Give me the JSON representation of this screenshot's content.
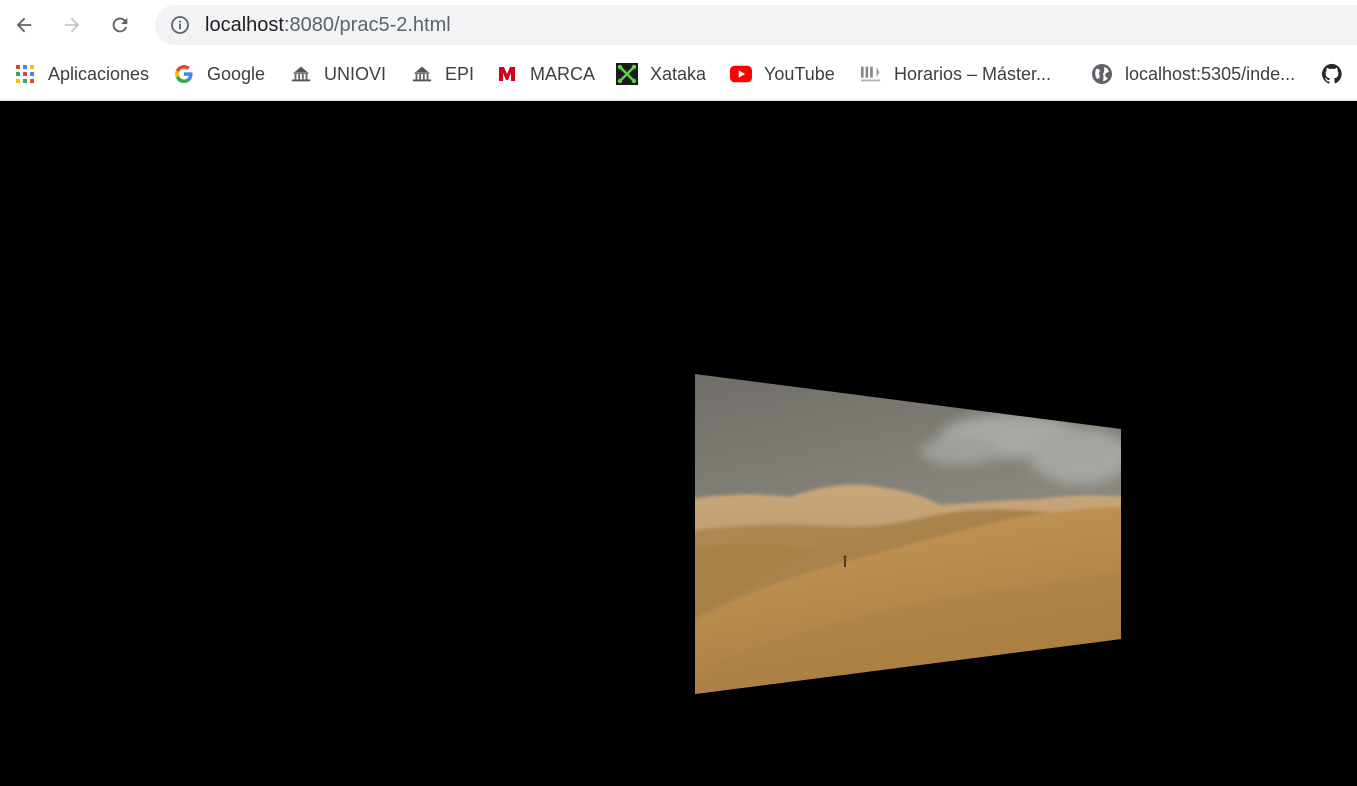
{
  "browser": {
    "url_host": "localhost",
    "url_rest": ":8080/prac5-2.html",
    "nav": {
      "back_icon": "arrow-left-icon",
      "forward_icon": "arrow-right-icon",
      "reload_icon": "reload-icon",
      "site_info_icon": "info-circle-icon"
    },
    "bookmarks": [
      {
        "label": "Aplicaciones",
        "icon": "apps-grid-icon"
      },
      {
        "label": "Google",
        "icon": "google-g-icon"
      },
      {
        "label": "UNIOVI",
        "icon": "uniovi-seal-icon"
      },
      {
        "label": "EPI",
        "icon": "epi-seal-icon"
      },
      {
        "label": "MARCA",
        "icon": "marca-logo-icon"
      },
      {
        "label": "Xataka",
        "icon": "xataka-logo-icon"
      },
      {
        "label": "YouTube",
        "icon": "youtube-logo-icon"
      },
      {
        "label": "Horarios – Máster...",
        "icon": "epi-doc-icon"
      },
      {
        "label": "localhost:5305/inde...",
        "icon": "globe-icon"
      },
      {
        "label": "",
        "icon": "github-icon"
      }
    ]
  },
  "page": {
    "background": "#000000",
    "scene": "desert-dunes-video-plane"
  }
}
